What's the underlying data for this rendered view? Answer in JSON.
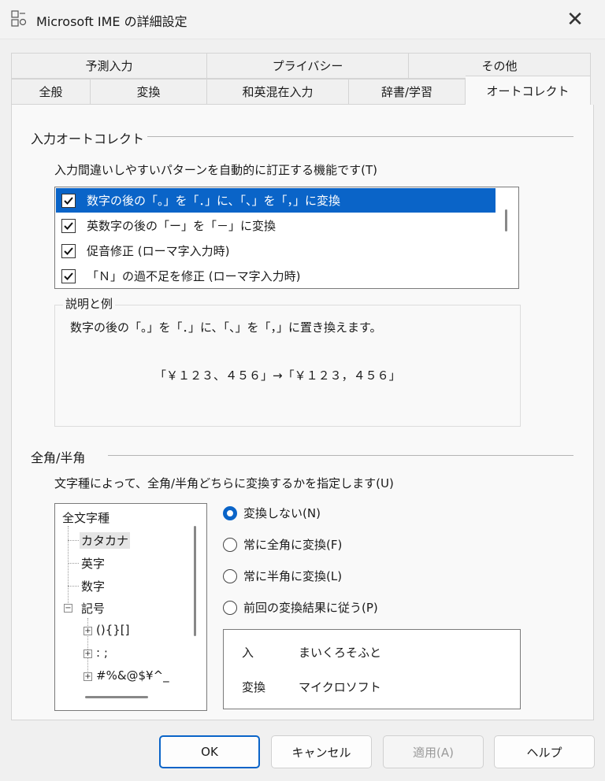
{
  "window": {
    "title": "Microsoft IME の詳細設定",
    "close_glyph": "✕"
  },
  "tabs_row1": [
    "予測入力",
    "プライバシー",
    "その他"
  ],
  "tabs_row2": [
    "全般",
    "変換",
    "和英混在入力",
    "辞書/学習",
    "オートコレクト"
  ],
  "active_tab": "オートコレクト",
  "autocorrect": {
    "section_title": "入力オートコレクト",
    "description": "入力間違いしやすいパターンを自動的に訂正する機能です(T)",
    "items": [
      {
        "label": "数字の後の「。」を「．」に、「、」を「，」に変換",
        "checked": true,
        "selected": true
      },
      {
        "label": "英数字の後の「ー」を「－」に変換",
        "checked": true,
        "selected": false
      },
      {
        "label": "促音修正 (ローマ字入力時)",
        "checked": true,
        "selected": false
      },
      {
        "label": "「Ｎ」の過不足を修正 (ローマ字入力時)",
        "checked": true,
        "selected": false
      }
    ]
  },
  "explanation": {
    "label": "説明と例",
    "text": "数字の後の「。」を「．」に、「、」を「，」に置き換えます。",
    "example": "「￥１２３、４５６」→「￥１２３，４５６」"
  },
  "width": {
    "section_title": "全角/半角",
    "description": "文字種によって、全角/半角どちらに変換するかを指定します(U)",
    "tree": {
      "root": "全文字種",
      "children": [
        "カタカナ",
        "英字",
        "数字",
        "記号"
      ],
      "symbol_children": [
        "(){}[]",
        ": ;",
        "#%&@$¥^_"
      ]
    },
    "options": [
      {
        "label": "変換しない(N)",
        "selected": true
      },
      {
        "label": "常に全角に変換(F)",
        "selected": false
      },
      {
        "label": "常に半角に変換(L)",
        "selected": false
      },
      {
        "label": "前回の変換結果に従う(P)",
        "selected": false
      }
    ],
    "example": {
      "input_label": "入",
      "input_value": "まいくろそふと",
      "conv_label": "変換",
      "conv_value": "マイクロソフト"
    }
  },
  "buttons": {
    "ok": "OK",
    "cancel": "キャンセル",
    "apply": "適用(A)",
    "help": "ヘルプ"
  },
  "colors": {
    "accent": "#0a64c8",
    "window_bg": "#f0f0f0"
  }
}
